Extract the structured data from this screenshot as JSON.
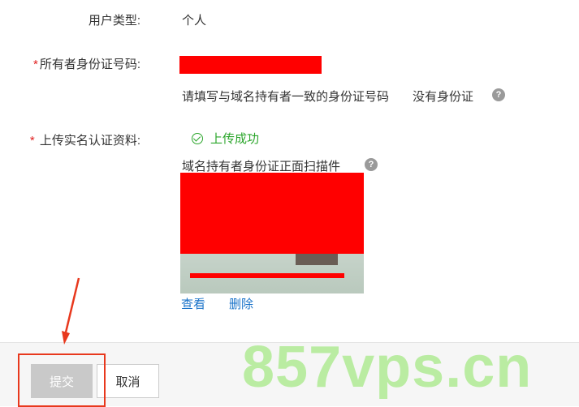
{
  "form": {
    "user_type": {
      "label": "用户类型:",
      "value": "个人"
    },
    "owner_id": {
      "required_mark": "*",
      "label": "所有者身份证号码:",
      "hint": "请填写与域名持有者一致的身份证号码",
      "no_id_link": "没有身份证",
      "help_glyph": "?"
    },
    "upload": {
      "required_mark": "*",
      "label": " 上传实名认证资料:",
      "status": "上传成功",
      "status_color": "#2aa52a",
      "doc_title": "域名持有者身份证正面扫描件",
      "help_glyph": "?",
      "view_label": "查看",
      "delete_label": "删除"
    }
  },
  "footer": {
    "submit_label": "提交",
    "cancel_label": "取消"
  },
  "watermark": {
    "text": "857vps.cn",
    "color": "#b4ec9a"
  },
  "colors": {
    "redaction": "#ff0000",
    "link": "#1a73c9",
    "annotation": "#e8381d"
  },
  "icons": {
    "success": "check-circle-icon",
    "help": "question-circle-icon"
  }
}
